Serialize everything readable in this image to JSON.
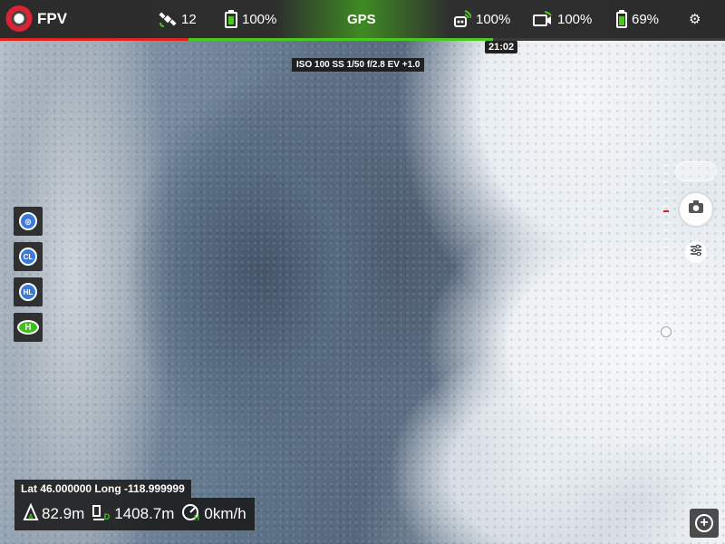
{
  "app": {
    "mode": "FPV",
    "logo_icon": "app-logo-icon"
  },
  "status_bar": {
    "satellites": "12",
    "rc_battery": "100%",
    "gps_label": "GPS",
    "rc_signal": "100%",
    "video_signal": "100%",
    "aircraft_battery": "69%",
    "settings_icon": "gear-icon"
  },
  "flight_time": "21:02",
  "camera_params": "ISO 100  SS 1/50  f/2.8  EV +1.0",
  "left_tools": [
    {
      "label": "",
      "icon": "poi-icon"
    },
    {
      "label": "CL"
    },
    {
      "label": "HL"
    },
    {
      "label": "H"
    }
  ],
  "telemetry": {
    "coords": "Lat 46.000000 Long -118.999999",
    "altitude": "82.9m",
    "distance": "1408.7m",
    "speed": "0km/h"
  },
  "colors": {
    "accent_green": "#49c81d",
    "alert_red": "#e0241e",
    "panel": "#191919"
  }
}
